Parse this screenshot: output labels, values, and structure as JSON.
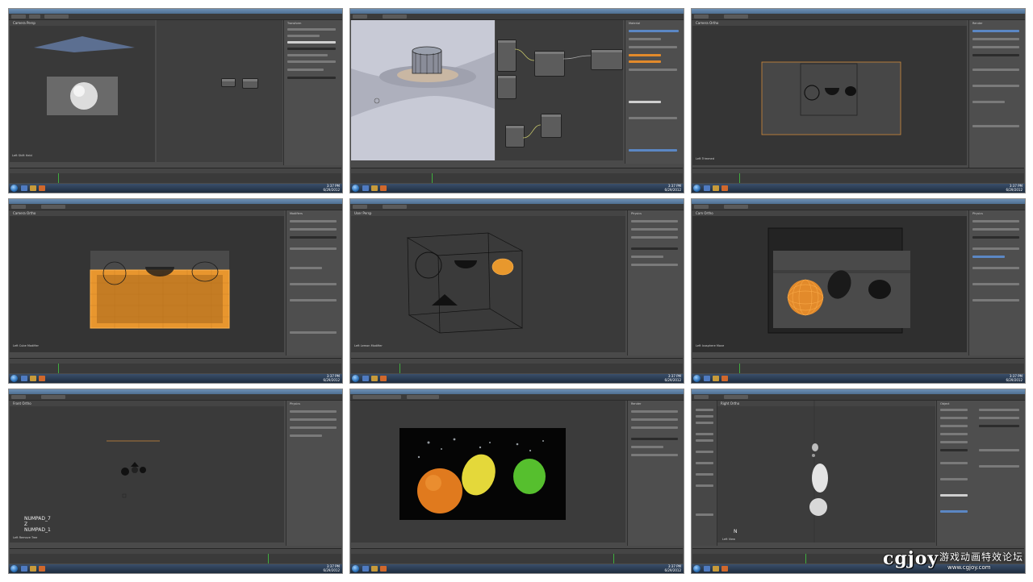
{
  "panels": [
    {
      "id": 1,
      "viewport_bottom_label": "Left Shift Held",
      "props_label": "Transform"
    },
    {
      "id": 2,
      "viewport_bottom_label": "",
      "props_label": "Material"
    },
    {
      "id": 3,
      "viewport_bottom_label": "Left Trimmed",
      "props_label": "Render"
    },
    {
      "id": 4,
      "viewport_bottom_label": "Left Cube Modifier",
      "props_label": "Modifiers"
    },
    {
      "id": 5,
      "viewport_bottom_label": "Left Lemon Modifier",
      "props_label": "Physics"
    },
    {
      "id": 6,
      "viewport_bottom_label": "Left Icosphere Move",
      "props_label": "Physics"
    },
    {
      "id": 7,
      "viewport_bottom_label": "Left Remove Tree",
      "props_label": "Physics"
    },
    {
      "id": 8,
      "viewport_bottom_label": "",
      "props_label": "Render"
    },
    {
      "id": 9,
      "viewport_bottom_label": "Left View",
      "props_label": "Object"
    }
  ],
  "panel7_keys": [
    "NUMPAD_7",
    "Z",
    "NUMPAD_1"
  ],
  "panel9_key": "N",
  "taskbar_time": "3:37 PM",
  "taskbar_date": "6/29/2012",
  "watermark": {
    "logo": "cgjoy",
    "chinese": "游戏动画特效论坛",
    "url": "www.cgjoy.com"
  },
  "colors": {
    "orange": "#e28a2b",
    "blender_bg": "#393939",
    "panel_bg": "#4e4e4e"
  }
}
